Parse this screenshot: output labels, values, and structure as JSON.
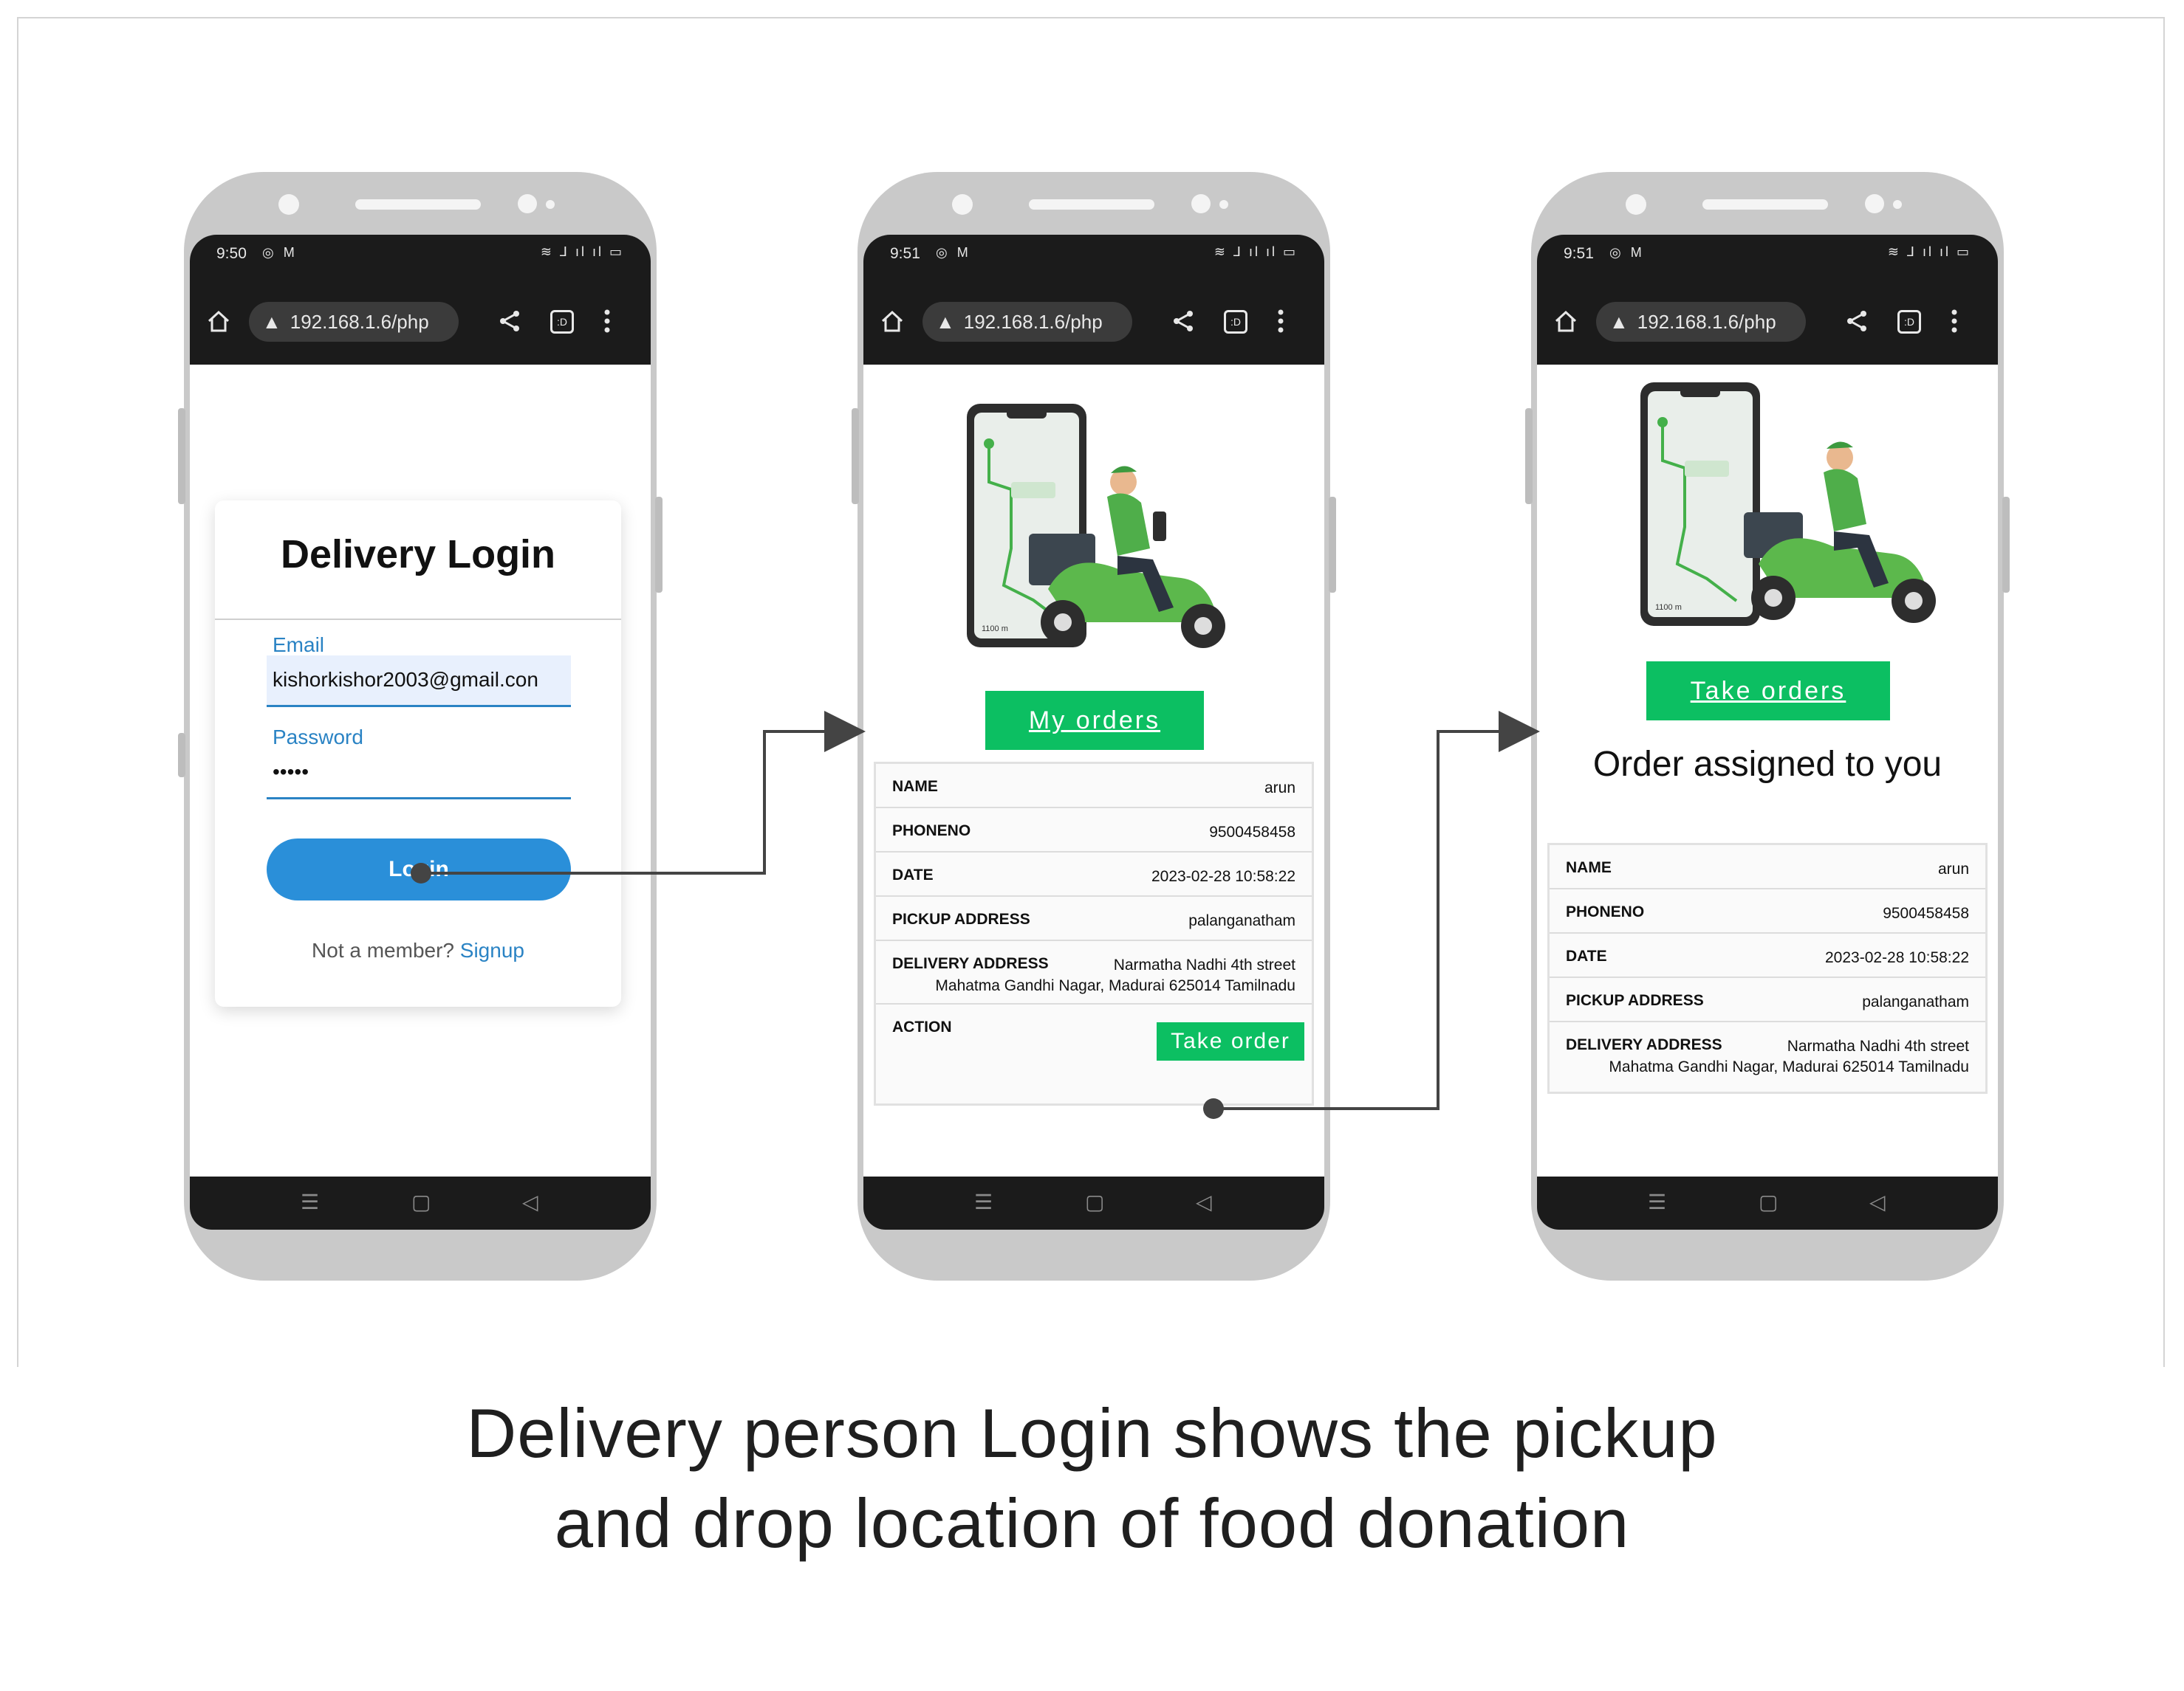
{
  "status_bar": {
    "phone1_time": "9:50",
    "phone2_time": "9:51",
    "phone3_time": "9:51",
    "left_icons": "◎ M",
    "right_icons": "≋ ⅃ ıl ıl ▭"
  },
  "browser": {
    "url": "192.168.1.6/php"
  },
  "login": {
    "title": "Delivery Login",
    "email_label": "Email",
    "email_value": "kishorkishor2003@gmail.con",
    "password_label": "Password",
    "password_value": "•••••",
    "login_button": "Login",
    "not_member": "Not a member?",
    "signup_link": "Signup"
  },
  "orders_screen": {
    "my_orders_button": "My orders",
    "rows": [
      {
        "key": "NAME",
        "value": "arun"
      },
      {
        "key": "PHONENO",
        "value": "9500458458"
      },
      {
        "key": "DATE",
        "value": "2023-02-28 10:58:22"
      },
      {
        "key": "PICKUP ADDRESS",
        "value": "palanganatham"
      },
      {
        "key": "DELIVERY ADDRESS",
        "value_line1": "Narmatha Nadhi 4th street",
        "value_line2": "Mahatma Gandhi Nagar, Madurai 625014 Tamilnadu"
      }
    ],
    "action_label": "ACTION",
    "take_order_button": "Take order"
  },
  "assigned_screen": {
    "take_orders_button": "Take orders",
    "heading": "Order assigned to you"
  },
  "illustration": {
    "distance1": "1100 m",
    "distance2": "1100 m"
  },
  "caption": {
    "line1": "Delivery person Login shows the pickup",
    "line2": "and drop location of food donation"
  },
  "colors": {
    "green": "#0cbf62",
    "blue": "#2a8fd9",
    "dark": "#1b1b1b"
  }
}
